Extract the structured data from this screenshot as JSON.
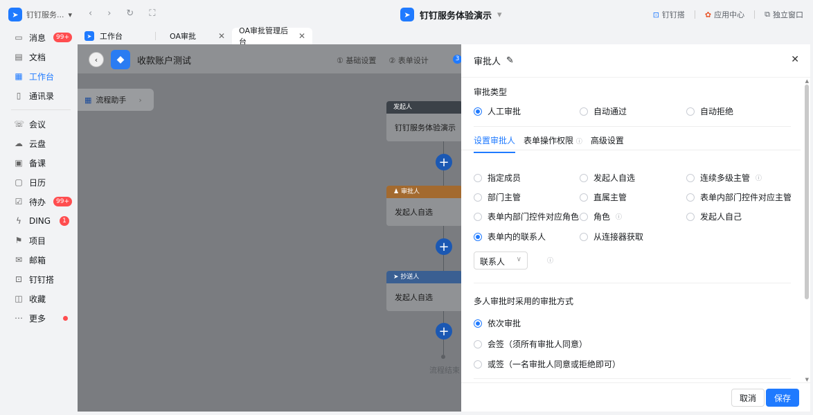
{
  "topbar": {
    "app_pill": "钉钉服务...",
    "page_title": "钉钉服务体验演示",
    "right_items": [
      "钉钉搭",
      "应用中心",
      "独立窗口"
    ]
  },
  "tabs": [
    {
      "label": "工作台"
    },
    {
      "label": "OA审批"
    },
    {
      "label": "OA审批管理后台"
    }
  ],
  "sidebar": {
    "items": [
      {
        "label": "消息",
        "badge": "99+"
      },
      {
        "label": "文档"
      },
      {
        "label": "工作台"
      },
      {
        "label": "通讯录"
      },
      {
        "label": "会议"
      },
      {
        "label": "云盘"
      },
      {
        "label": "备课"
      },
      {
        "label": "日历"
      },
      {
        "label": "待办",
        "badge": "99+"
      },
      {
        "label": "DING",
        "badge": "1"
      },
      {
        "label": "项目"
      },
      {
        "label": "邮箱"
      },
      {
        "label": "钉钉搭"
      },
      {
        "label": "收藏"
      },
      {
        "label": "更多"
      }
    ]
  },
  "form": {
    "name": "收款账户测试",
    "steps": [
      "① 基础设置",
      "② 表单设计"
    ],
    "step3_num": "3"
  },
  "flow": {
    "helper": "流程助手",
    "nodes": [
      {
        "head": "发起人",
        "body": "钉钉服务体验演示"
      },
      {
        "head": "审批人",
        "body": "发起人自选"
      },
      {
        "head": "抄送人",
        "body": "发起人自选"
      }
    ],
    "end": "流程结束"
  },
  "drawer": {
    "title": "审批人",
    "approval_type_title": "审批类型",
    "approval_types": [
      "人工审批",
      "自动通过",
      "自动拒绝"
    ],
    "subtabs": [
      "设置审批人",
      "表单操作权限",
      "高级设置"
    ],
    "approver_options": [
      "指定成员",
      "发起人自选",
      "连续多级主管",
      "部门主管",
      "直属主管",
      "表单内部门控件对应主管",
      "表单内部门控件对应角色",
      "角色",
      "发起人自己",
      "表单内的联系人",
      "从连接器获取"
    ],
    "select_value": "联系人",
    "multi_title": "多人审批时采用的审批方式",
    "multi_options": [
      "依次审批",
      "会签（须所有审批人同意）",
      "或签（一名审批人同意或拒绝即可）"
    ],
    "cancel": "取消",
    "save": "保存"
  }
}
